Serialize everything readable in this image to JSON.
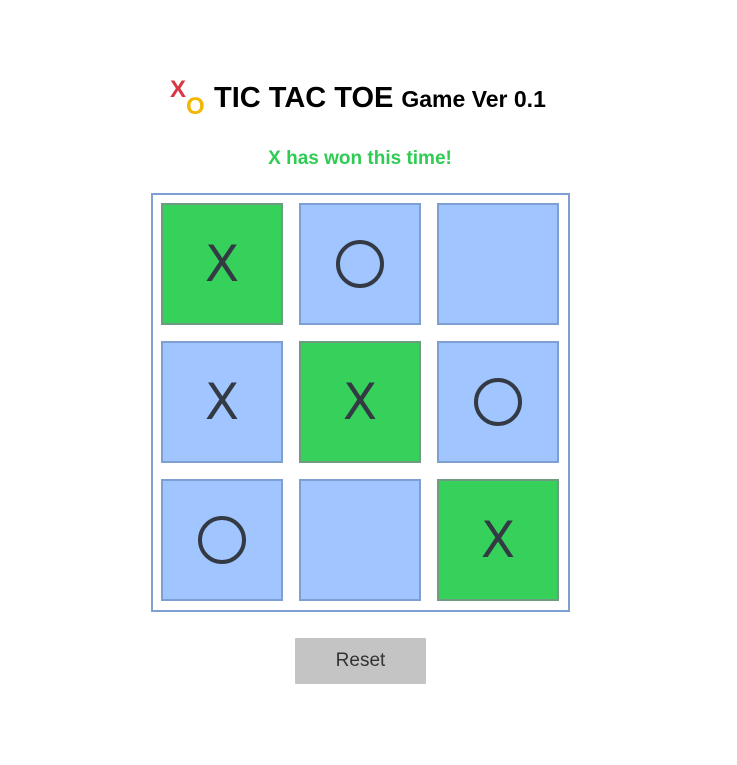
{
  "header": {
    "logo_x": "X",
    "logo_o": "O",
    "title_main": "TIC TAC TOE",
    "title_sub": "Game Ver 0.1"
  },
  "status": {
    "text": "X has won this time!",
    "color": "#2ecc52"
  },
  "board": {
    "cells": [
      {
        "mark": "X",
        "winning": true
      },
      {
        "mark": "O",
        "winning": false
      },
      {
        "mark": "",
        "winning": false
      },
      {
        "mark": "X",
        "winning": false
      },
      {
        "mark": "X",
        "winning": true
      },
      {
        "mark": "O",
        "winning": false
      },
      {
        "mark": "O",
        "winning": false
      },
      {
        "mark": "",
        "winning": false
      },
      {
        "mark": "X",
        "winning": true
      }
    ],
    "colors": {
      "cell": "#a1c5ff",
      "win": "#36d15a",
      "border": "#7d9fd1",
      "mark": "#333a44"
    }
  },
  "controls": {
    "reset_label": "Reset"
  }
}
